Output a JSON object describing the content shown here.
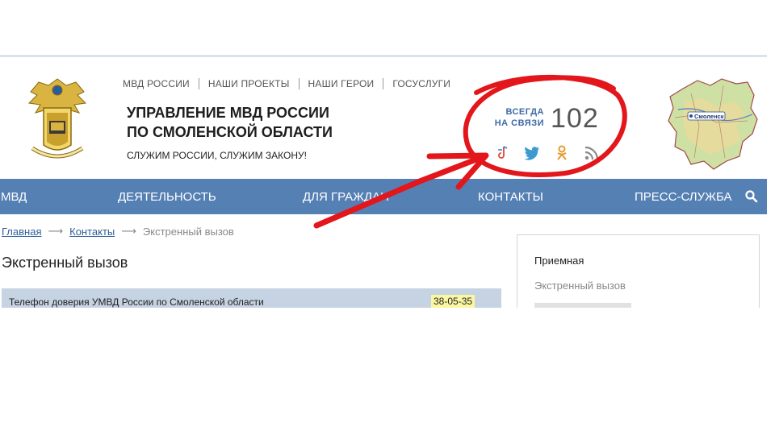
{
  "header": {
    "top_links": [
      "МВД России",
      "Наши проекты",
      "Наши герои",
      "Госуслуги"
    ],
    "title_line1": "Управление МВД России",
    "title_line2": "по Смоленской области",
    "slogan": "Служим России, служим закону!",
    "contact_label_line1": "Всегда",
    "contact_label_line2": "на связи",
    "contact_number": "102",
    "social_icons": [
      "vk-music-icon",
      "twitter-icon",
      "odnoklassniki-icon",
      "rss-icon"
    ],
    "map_label": "Смоленск"
  },
  "nav": {
    "items": [
      "МВД",
      "Деятельность",
      "Для граждан",
      "Контакты",
      "Пресс-служба"
    ]
  },
  "breadcrumb": {
    "home": "Главная",
    "contacts": "Контакты",
    "current": "Экстренный вызов"
  },
  "main": {
    "title": "Экстренный вызов",
    "rows": [
      {
        "label": "Телефон доверия УМВД России по Смоленской области",
        "value": "38-05-35"
      }
    ]
  },
  "sidebar": {
    "items": [
      "Приемная",
      "Экстренный вызов"
    ]
  },
  "colors": {
    "nav_bg": "#5580b4",
    "contact_accent": "#3b6aa6",
    "row_bg": "#c5d3e3",
    "highlight": "#fbf7a1",
    "annotation": "#e2161b"
  }
}
